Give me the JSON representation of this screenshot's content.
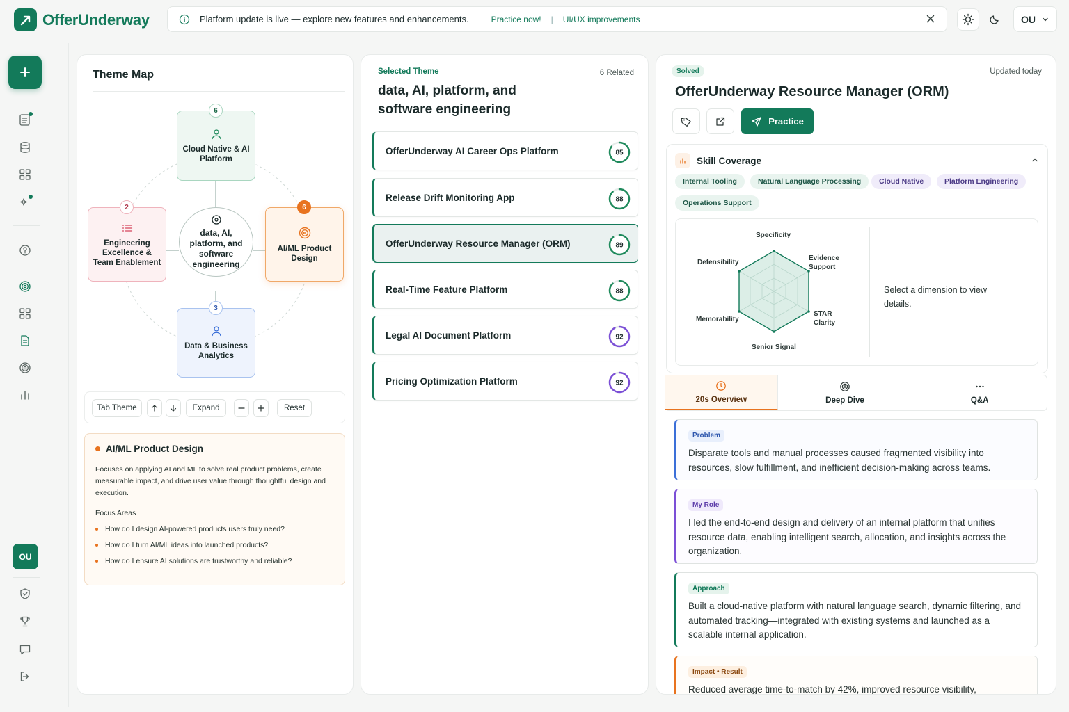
{
  "app": {
    "name": "OfferUnderway"
  },
  "banner": {
    "message": "Platform update is live — explore new features and enhancements.",
    "link_practice": "Practice now!",
    "separator": "|",
    "link_ui": "UI/UX improvements"
  },
  "user": {
    "initials": "OU"
  },
  "theme_map": {
    "title": "Theme Map",
    "center": "data, AI, platform, and software engineering",
    "nodes": {
      "top": {
        "label": "Cloud Native & AI Platform",
        "count": "6"
      },
      "left": {
        "label": "Engineering Excellence & Team Enablement",
        "count": "2"
      },
      "right": {
        "label": "AI/ML Product Design",
        "count": "6"
      },
      "bottom": {
        "label": "Data & Business Analytics",
        "count": "3"
      }
    },
    "controls": {
      "tab_theme": "Tab Theme",
      "expand": "Expand",
      "reset": "Reset"
    },
    "detail": {
      "title": "AI/ML Product Design",
      "description": "Focuses on applying AI and ML to solve real product problems, create measurable impact, and drive user value through thoughtful design and execution.",
      "focus_label": "Focus Areas",
      "focus_areas": [
        "How do I design AI-powered products users truly need?",
        "How do I turn AI/ML ideas into launched products?",
        "How do I ensure AI solutions are trustworthy and reliable?"
      ]
    }
  },
  "selected_theme": {
    "label": "Selected Theme",
    "related": "6 Related",
    "title": "data, AI, platform, and software engineering",
    "projects": [
      {
        "name": "OfferUnderway AI Career Ops Platform",
        "score": 85,
        "color": "#1f8a5c",
        "selected": false
      },
      {
        "name": "Release Drift Monitoring App",
        "score": 88,
        "color": "#1f8a5c",
        "selected": false
      },
      {
        "name": "OfferUnderway Resource Manager (ORM)",
        "score": 89,
        "color": "#1f8a5c",
        "selected": true
      },
      {
        "name": "Real-Time Feature Platform",
        "score": 88,
        "color": "#1f8a5c",
        "selected": false
      },
      {
        "name": "Legal AI Document Platform",
        "score": 92,
        "color": "#7b4fd6",
        "selected": false
      },
      {
        "name": "Pricing Optimization Platform",
        "score": 92,
        "color": "#7b4fd6",
        "selected": false
      }
    ]
  },
  "detail": {
    "status": "Solved",
    "updated": "Updated today",
    "title": "OfferUnderway Resource Manager (ORM)",
    "practice_label": "Practice",
    "skill_coverage": {
      "title": "Skill Coverage",
      "chips": [
        {
          "label": "Internal Tooling",
          "tone": "g"
        },
        {
          "label": "Natural Language Processing",
          "tone": "g"
        },
        {
          "label": "Cloud Native",
          "tone": "p"
        },
        {
          "label": "Platform Engineering",
          "tone": "p"
        },
        {
          "label": "Operations Support",
          "tone": "g"
        }
      ],
      "dimensions": [
        "Specificity",
        "Evidence Support",
        "STAR Clarity",
        "Senior Signal",
        "Memorability",
        "Defensibility"
      ],
      "hint": "Select a dimension to view details."
    },
    "tabs": [
      "20s Overview",
      "Deep Dive",
      "Q&A"
    ],
    "sections": [
      {
        "tag": "Problem",
        "text": "Disparate tools and manual processes caused fragmented visibility into resources, slow fulfillment, and inefficient decision-making across teams."
      },
      {
        "tag": "My Role",
        "text": "I led the end-to-end design and delivery of an internal platform that unifies resource data, enabling intelligent search, allocation, and insights across the organization."
      },
      {
        "tag": "Approach",
        "text": "Built a cloud-native platform with natural language search, dynamic filtering, and automated tracking—integrated with existing systems and launched as a scalable internal application."
      },
      {
        "tag": "Impact • Result",
        "text": "Reduced average time-to-match by 42%, improved resource visibility,"
      }
    ]
  },
  "colors": {
    "brand": "#137a5a",
    "orange": "#e8731f",
    "purple": "#7b4fd6",
    "blue": "#3b6fd8",
    "pink": "#d6455d"
  }
}
